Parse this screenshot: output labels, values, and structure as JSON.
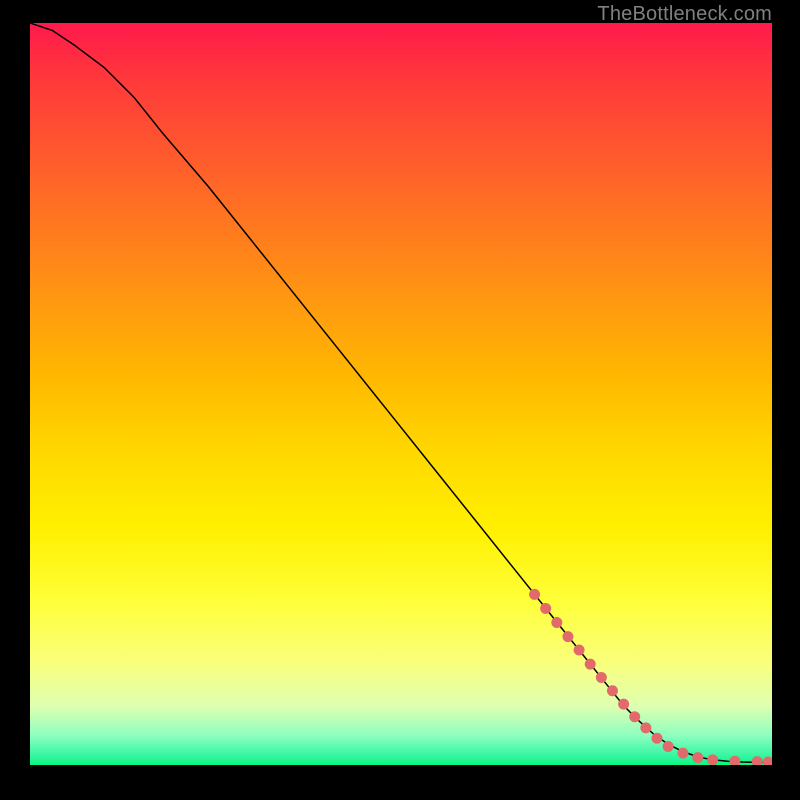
{
  "watermark": "TheBottleneck.com",
  "chart_data": {
    "type": "line",
    "title": "",
    "xlabel": "",
    "ylabel": "",
    "xlim": [
      0,
      100
    ],
    "ylim": [
      0,
      100
    ],
    "grid": false,
    "legend": false,
    "series": [
      {
        "name": "curve",
        "stroke": "#000000",
        "stroke_width": 1.5,
        "x": [
          0,
          3,
          6,
          10,
          14,
          18,
          24,
          30,
          36,
          42,
          48,
          54,
          60,
          66,
          70,
          74,
          78,
          80,
          82,
          84,
          86,
          88,
          90,
          92,
          94,
          96,
          98,
          100
        ],
        "y": [
          100,
          99,
          97,
          94,
          90,
          85,
          78,
          70.5,
          63,
          55.5,
          48,
          40.5,
          33,
          25.5,
          20.5,
          15.5,
          10.5,
          8,
          6,
          4.2,
          2.8,
          1.8,
          1.1,
          0.7,
          0.5,
          0.4,
          0.35,
          0.35
        ]
      },
      {
        "name": "dotted-overlay",
        "type": "scatter",
        "color": "#e26a6a",
        "radius": 5.5,
        "x": [
          68,
          69.5,
          71,
          72.5,
          74,
          75.5,
          77,
          78.5,
          80,
          81.5,
          83,
          84.5,
          86,
          88,
          90,
          92,
          95,
          98,
          99.5
        ],
        "y": [
          23,
          21.1,
          19.2,
          17.3,
          15.5,
          13.6,
          11.8,
          10,
          8.2,
          6.5,
          5,
          3.6,
          2.5,
          1.6,
          1.0,
          0.7,
          0.5,
          0.45,
          0.4
        ]
      }
    ]
  }
}
